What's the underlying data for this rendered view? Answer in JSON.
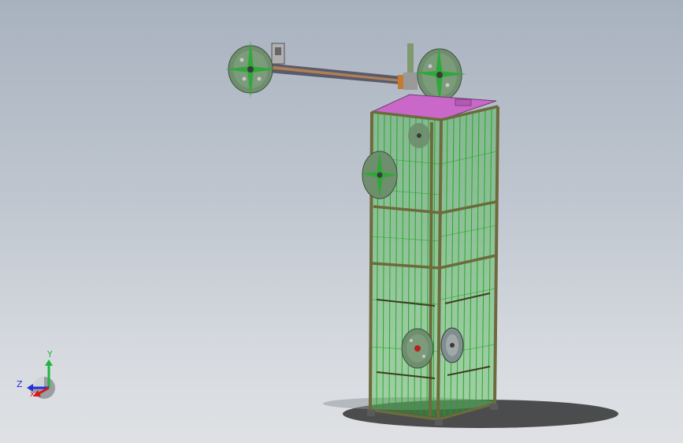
{
  "viewport": {
    "triad": {
      "y_label": "Y",
      "z_label": "Z",
      "x_label": "X",
      "colors": {
        "y": "#1db63b",
        "z": "#2231d6",
        "x": "#d51a1a"
      }
    },
    "model_colors": {
      "frame": "#6b6b3c",
      "mesh": "#1ea51e",
      "top_plate": "#c968c9",
      "reel": "#6f8f6f",
      "spoke": "#2fa83a",
      "arm": "#4a4a5e"
    }
  }
}
